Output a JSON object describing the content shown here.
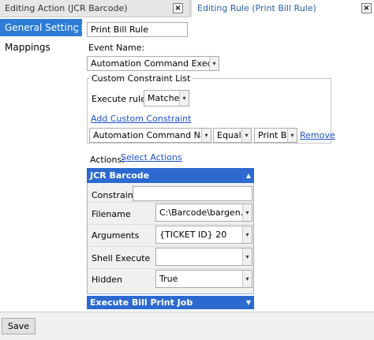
{
  "left_panel": {
    "title": "Editing Action (JCR Barcode)",
    "close": "×",
    "items": [
      {
        "label": "General Settings"
      },
      {
        "label": "Mappings"
      }
    ]
  },
  "right_panel": {
    "title": "Editing Rule (Print Bill Rule)",
    "rule_name": "Print Bill Rule",
    "event_name_label": "Event Name:",
    "event_name_value": "Automation Command Executed",
    "custom_constraint_title": "Custom Constraint List",
    "execute_rule_label": "Execute rule if",
    "execute_rule_value": "Matches",
    "add_constraint_link": "Add Custom Constraint",
    "constraint_row": {
      "field": "Automation Command Name",
      "operator": "Equals",
      "value": "Print Bill",
      "remove": "Remove"
    },
    "actions_label": "Actions:",
    "select_actions_link": "Select Actions",
    "action_1": {
      "header": "JCR Barcode",
      "constraint_label": "Constraint:",
      "constraint_value": "",
      "filename_label": "Filename",
      "filename_value": "C:\\Barcode\\bargen.bat",
      "arguments_label": "Arguments",
      "arguments_value": "{TICKET ID} 20",
      "shell_label": "Shell Execute",
      "shell_value": "",
      "hidden_label": "Hidden",
      "hidden_value": "True"
    },
    "action_2": {
      "header": "Execute Bill Print Job"
    }
  },
  "bottom": {
    "save_label": "Save"
  },
  "icons": {
    "dropdown_glyph": "▾",
    "collapse_glyph": "▲",
    "expand_glyph": "▼"
  },
  "colors": {
    "accent": "#2c7bd6",
    "action_header": "#2c6ad0",
    "link": "#1a4fcf"
  }
}
